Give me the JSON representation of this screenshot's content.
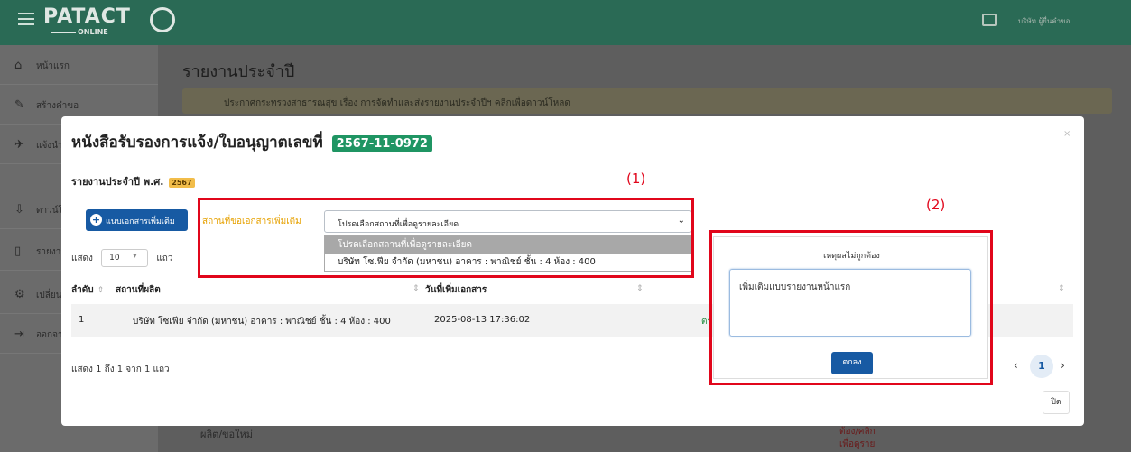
{
  "navbar": {
    "logo_text": "PATACT",
    "logo_sub": "ONLINE",
    "user": "บริษัท ผู้ยื่นคำขอ"
  },
  "sidebar": {
    "items": [
      {
        "icon": "home-icon",
        "label": "หน้าแรก"
      },
      {
        "icon": "pencil-icon",
        "label": "สร้างคำขอ"
      },
      {
        "icon": "plane-icon",
        "label": "แจ้งนำผ่าน"
      },
      {
        "icon": "upload-icon",
        "label": "ดาวน์โหลด"
      },
      {
        "icon": "file-icon",
        "label": "รายงาน"
      },
      {
        "icon": "gear-icon",
        "label": "เปลี่ยนรหัส"
      },
      {
        "icon": "logout-icon",
        "label": "ออกจากระบบ"
      }
    ]
  },
  "background": {
    "page_title": "รายงานประจำปี",
    "announcement": "ประกาศกระทรวงสาธารณสุข เรื่อง การจัดทำและส่งรายงานประจำปีฯ คลิกเพื่อดาวน์โหลด",
    "footer_left": "ผลิต/ขอใหม่",
    "footer_red_1": "ต้อง/คลิก",
    "footer_red_2": "เพื่อดูราย"
  },
  "modal": {
    "title": "หนังสือรับรองการแจ้ง/ใบอนุญาตเลขที่",
    "license_no": "2567-11-0972",
    "close": "×",
    "report_label": "รายงานประจำปี พ.ศ.",
    "year": "2567",
    "add_button": "แนบเอกสารเพิ่มเติม",
    "show_label": "แสดง",
    "entries_value": "10",
    "rows_label": "แถว",
    "location_label": "สถานที่ขอเอกสารเพิ่มเติม",
    "location_select": "โปรดเลือกสถานที่เพื่อดูรายละเอียด",
    "dropdown_options": [
      "โปรดเลือกสถานที่เพื่อดูรายละเอียด",
      "บริษัท โซเฟีย จำกัด (มหาชน) อาคาร : พาณิชย์ ชั้น : 4 ห้อง : 400"
    ],
    "table": {
      "headers": [
        "ลำดับ",
        "สถานที่ผลิต",
        "วันที่เพิ่มเอกสาร"
      ],
      "rows": [
        {
          "no": "1",
          "site": "บริษัท โซเฟีย จำกัด (มหาชน) อาคาร : พาณิชย์ ชั้น : 4 ห้อง : 400",
          "date": "2025-08-13 17:36:02",
          "status": "ตร"
        }
      ]
    },
    "info": "แสดง 1 ถึง 1 จาก 1 แถว",
    "page": "1",
    "close_button": "ปิด"
  },
  "reason_popup": {
    "title": "เหตุผลไม่ถูกต้อง",
    "text": "เพิ่มเติมแบบรายงานหน้าแรก",
    "ok_button": "ตกลง"
  },
  "annotations": {
    "label_1": "(1)",
    "label_2": "(2)"
  },
  "colors": {
    "navbar": "#2a6a55",
    "badge_green": "#1f9563",
    "primary": "#175aa3",
    "annotation_red": "#e1061b",
    "label_orange": "#e6a100"
  }
}
